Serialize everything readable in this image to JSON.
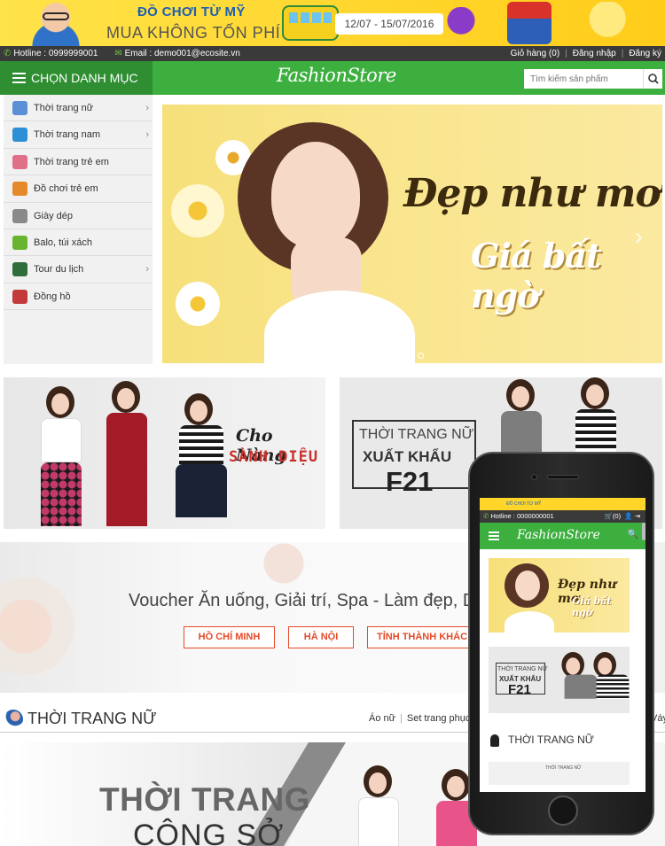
{
  "promo_banner": {
    "line1": "ĐỒ CHƠI TỪ MỸ",
    "line2": "MUA KHÔNG TỐN PHÍ",
    "date_range": "12/07 - 15/07/2016"
  },
  "info_bar": {
    "hotline": "Hotline : 0999999001",
    "email": "Email : demo001@ecosite.vn",
    "cart": "Giỏ hàng (0)",
    "login": "Đăng nhập",
    "register": "Đăng ký"
  },
  "header": {
    "category_label": "CHỌN DANH MỤC",
    "logo": "FashionStore",
    "search_placeholder": "Tìm kiếm sản phẩm"
  },
  "sidebar": {
    "items": [
      {
        "label": "Thời trang nữ",
        "icon": "woman-icon",
        "color": "#5b8fd6",
        "has_sub": true
      },
      {
        "label": "Thời trang nam",
        "icon": "shirt-icon",
        "color": "#2d8fd5",
        "has_sub": true
      },
      {
        "label": "Thời trang trẻ em",
        "icon": "kid-icon",
        "color": "#e0708a",
        "has_sub": false
      },
      {
        "label": "Đồ chơi trẻ em",
        "icon": "toy-icon",
        "color": "#e58a2a",
        "has_sub": false
      },
      {
        "label": "Giày dép",
        "icon": "shoe-icon",
        "color": "#8a8a8a",
        "has_sub": false
      },
      {
        "label": "Balo, túi xách",
        "icon": "bag-icon",
        "color": "#69b42f",
        "has_sub": false
      },
      {
        "label": "Tour du lịch",
        "icon": "tour-icon",
        "color": "#2f6e3a",
        "has_sub": true
      },
      {
        "label": "Đồng hồ",
        "icon": "watch-icon",
        "color": "#c23a3a",
        "has_sub": false
      }
    ]
  },
  "hero": {
    "headline": "Đẹp như mơ",
    "subline": "Giá bất ngờ",
    "slides": 3,
    "active_slide": 1
  },
  "tiles": {
    "left": {
      "line1": "Cho Nàng",
      "line2": "SÀNH ĐIỆU"
    },
    "right": {
      "line1": "THỜI TRANG NỮ",
      "line2": "XUẤT KHẨU",
      "line3": "F21"
    }
  },
  "voucher": {
    "title": "Voucher Ăn uống, Giải trí, Spa - Làm đẹp, D",
    "buttons": [
      "HỒ CHÍ MINH",
      "HÀ NỘI",
      "TỈNH THÀNH KHÁC"
    ]
  },
  "section": {
    "title": "THỜI TRANG NỮ",
    "links": [
      "Áo nữ",
      "Set trang phục"
    ],
    "far_link": "Váy"
  },
  "bottom_banner": {
    "line1": "THỜI TRANG",
    "line2": "CÔNG SỞ"
  },
  "mobile": {
    "promo": "ĐỒ CHƠI TỪ MỸ",
    "hotline": "Hotline : 0000000001",
    "cart": "(0)",
    "logo": "FashionStore",
    "hero_headline": "Đẹp như mơ",
    "hero_subline": "Giá bất ngờ",
    "tile_line1": "THỜI TRANG NỮ",
    "tile_line2": "XUẤT KHẨU",
    "tile_line3": "F21",
    "section_title": "THỜI TRANG NỮ",
    "strip_text": "THỜI TRANG NỮ"
  },
  "colors": {
    "brand_green": "#3daf3f",
    "dark_green": "#2e8e31",
    "accent_red": "#e54a2a",
    "info_bar": "#3a3a3a",
    "promo_yellow": "#ffd52a"
  }
}
